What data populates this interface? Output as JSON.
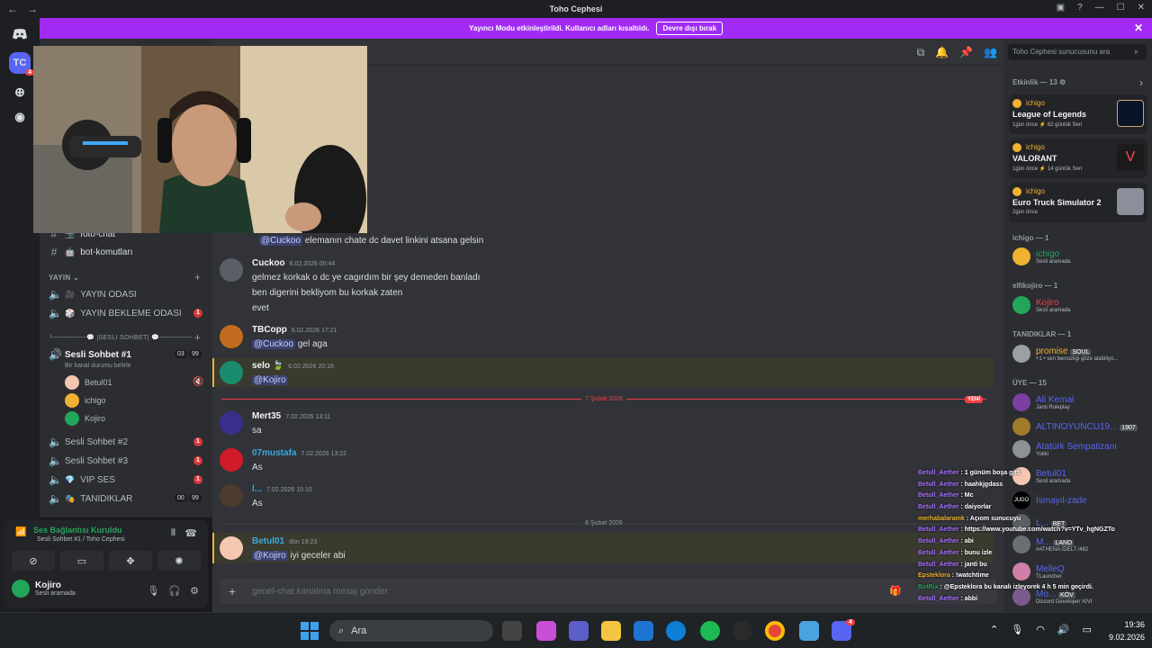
{
  "window": {
    "title": "Toho Cephesi",
    "back": "←",
    "forward": "→",
    "minimize": "—",
    "maximize": "☐",
    "close": "✕"
  },
  "banner": {
    "text": "Yayıncı Modu etkinleştirildi. Kullanıcı adları kısaltıldı.",
    "button": "Devre dışı bırak"
  },
  "guilds": {
    "server_initials": "TC",
    "server_badge": "4"
  },
  "sidebar": {
    "text_channels": [
      {
        "name": "foto-chat",
        "emoji": "📷"
      },
      {
        "name": "bot-komutları",
        "emoji": "🤖"
      }
    ],
    "category_yayin": "YAYIN",
    "yayin_channels": [
      {
        "name": "YAYIN ODASI",
        "emoji": "🎥"
      },
      {
        "name": "YAYIN BEKLEME ODASI",
        "emoji": "🎲",
        "badge": "1"
      }
    ],
    "category_sesli": "└───────💬 |SESLİ SOHBET| 💬───────",
    "active_voice": {
      "name": "Sesli Sohbet #1",
      "emoji": "🔊",
      "count": "03",
      "limit": "99",
      "status": "Bir kanal durumu belirle"
    },
    "voice_users": [
      "Betul01",
      "ichigo",
      "Kojiro"
    ],
    "voice_channels": [
      {
        "name": "Sesli Sohbet #2",
        "emoji": "🔊",
        "badge": "1"
      },
      {
        "name": "Sesli Sohbet #3",
        "emoji": "🔊",
        "badge": "1"
      },
      {
        "name": "VIP SES",
        "emoji": "💎",
        "badge": "1"
      },
      {
        "name": "TANIDIKLAR",
        "emoji": "🎭",
        "count": "00",
        "limit": "99"
      }
    ]
  },
  "voice_panel": {
    "status": "Ses Bağlantısı Kuruldu",
    "channel": "Sesli Sohbet #1 / Toho Cephesi",
    "user": "Kojiro",
    "user_status": "Sesli aramada"
  },
  "messages": [
    {
      "author": "",
      "time": "",
      "lines": [],
      "mention": "@Cuckoo",
      "text": "elemanın chate dc davet linkini atsana gelsin"
    },
    {
      "author": "Cuckoo",
      "time": "6.02.2026 00:44",
      "lines": [
        "gelmez korkak o dc ye cagırdım bir şey demeden banladı",
        "ben digerini bekliyom bu korkak zaten",
        "evet"
      ]
    },
    {
      "author": "TBCopp",
      "time": "6.02.2026 17:21",
      "mention": "@Cuckoo",
      "text": "gel aga"
    },
    {
      "author": "selo 🍃",
      "time": "6.02.2026 20:16",
      "mention": "@Kojiro",
      "text": ""
    },
    {
      "author": "Mert35",
      "time": "7.02.2026 13:11",
      "text": "sa"
    },
    {
      "author": "07mustafa",
      "time": "7.02.2026 13:22",
      "text": "As"
    },
    {
      "author": "l...",
      "time": "7.02.2026 15:10",
      "text": "As"
    },
    {
      "author": "Betul01",
      "time": "dün 19:23",
      "mention": "@Kojiro",
      "text": "iyi geceler abi"
    }
  ],
  "dividers": {
    "d1": "7 Şubat 2026",
    "new": "YENİ",
    "d2": "8 Şubat 2026"
  },
  "input": {
    "placeholder": "genel-chat kanalına mesaj gönder"
  },
  "members": {
    "search_placeholder": "Toho Cephesi sunucusunu ara",
    "activity_header": "Etkinlik — 13",
    "activities": [
      {
        "user": "ichigo",
        "game": "League of Legends",
        "sub": "1gün önce  ⚡ 62 günlük Seri",
        "color": "#c8aa6e"
      },
      {
        "user": "ichigo",
        "game": "VALORANT",
        "sub": "1gün önce  ⚡ 14 günlük Seri",
        "color": "#ff4655"
      },
      {
        "user": "ichigo",
        "game": "Euro Truck Simulator 2",
        "sub": "2gün önce",
        "color": "#8a8f99"
      }
    ],
    "groups": [
      {
        "header": "ichigo — 1",
        "items": [
          {
            "name": "ichigo",
            "sub": "Sesli aramada",
            "color": "#23a55a"
          }
        ]
      },
      {
        "header": "elfikojiro — 1",
        "items": [
          {
            "name": "Kojiro",
            "sub": "Sesli aramada",
            "color": "#f23f43"
          }
        ]
      },
      {
        "header": "TANIDIKLAR — 1",
        "items": [
          {
            "name": "promise",
            "tag": "SOUL",
            "sub": "+1 • sen bensizligi göze alabiliyo...",
            "color": "#f0b232"
          }
        ]
      },
      {
        "header": "ÜYE — 15",
        "items": [
          {
            "name": "Ali Kemal",
            "sub": "Janti Roleplay",
            "color": "#5865f2"
          },
          {
            "name": "ALTINOYUNCU19...",
            "tag": "1907",
            "sub": "",
            "color": "#5865f2"
          },
          {
            "name": "Atatürk Sempatizanı",
            "sub": "Yokki",
            "color": "#5865f2"
          },
          {
            "name": "Betul01",
            "sub": "Sesli aramada",
            "color": "#5865f2"
          },
          {
            "name": "İsmayıl-zade",
            "sub": "",
            "color": "#5865f2"
          },
          {
            "name": "L...",
            "tag": "BET",
            "sub": "",
            "color": "#5865f2"
          },
          {
            "name": "M...",
            "tag": "LAND",
            "sub": "#ATHENA /DELT /482",
            "color": "#5865f2"
          },
          {
            "name": "MelleQ",
            "sub": "TLauncher",
            "color": "#5865f2"
          },
          {
            "name": "Mo...",
            "tag": "KÖV",
            "sub": "Discord Developer XIVI",
            "color": "#5865f2"
          }
        ]
      }
    ]
  },
  "stream_chat": [
    {
      "user": "Betull_Aether",
      "msg": "1 günüm boşa gitti"
    },
    {
      "user": "Betull_Aether",
      "msg": "haahkjgdass"
    },
    {
      "user": "Betull_Aether",
      "msg": "Mc"
    },
    {
      "user": "Betull_Aether",
      "msg": "daiyorlar"
    },
    {
      "user": "merhabalaramk",
      "msg": "Açıom sunucuyu"
    },
    {
      "user": "Betull_Aether",
      "msg": "https://www.youtube.com/watch?v=YTv_hgNGZTo"
    },
    {
      "user": "Betull_Aether",
      "msg": "abi"
    },
    {
      "user": "Betull_Aether",
      "msg": "bunu izle"
    },
    {
      "user": "Betull_Aether",
      "msg": "janti bu"
    },
    {
      "user": "Epsteklora",
      "msg": "!watchtime"
    },
    {
      "user": "BotRix",
      "msg": "@Epsteklora bu kanalı izleyorek 4 h 5 min geçirdi."
    },
    {
      "user": "Betull_Aether",
      "msg": "abbi"
    }
  ],
  "taskbar": {
    "search": "Ara",
    "time": "19:36",
    "date": "9.02.2026",
    "discord_badge": "4"
  }
}
